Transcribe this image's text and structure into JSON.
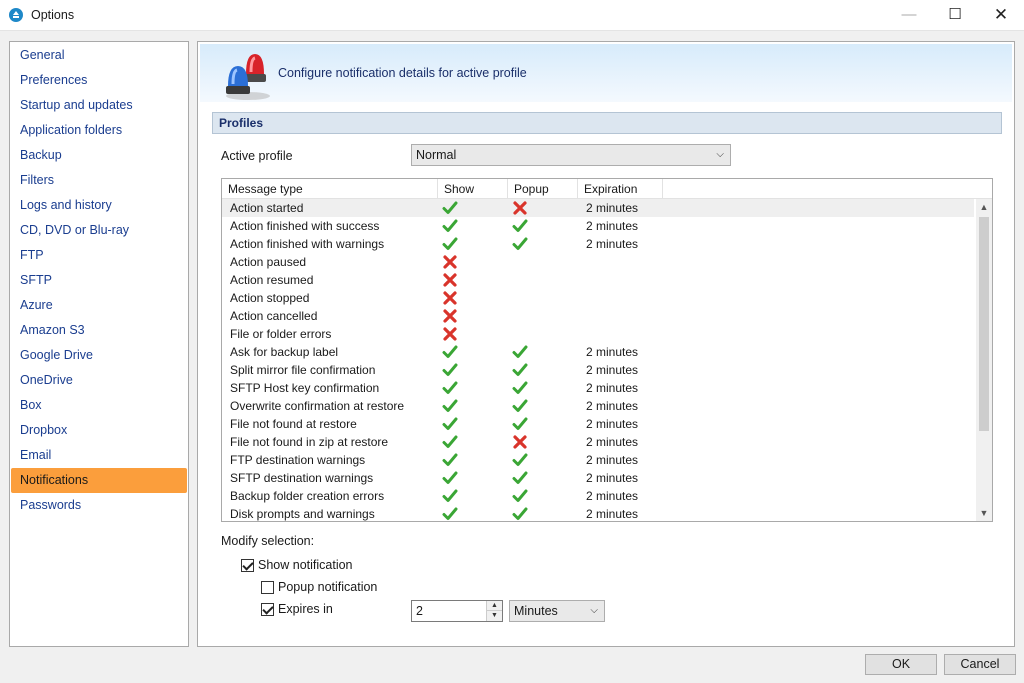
{
  "window": {
    "title": "Options"
  },
  "sidebar": {
    "items": [
      {
        "label": "General"
      },
      {
        "label": "Preferences"
      },
      {
        "label": "Startup and updates"
      },
      {
        "label": "Application folders"
      },
      {
        "label": "Backup"
      },
      {
        "label": "Filters"
      },
      {
        "label": "Logs and history"
      },
      {
        "label": "CD, DVD or Blu-ray"
      },
      {
        "label": "FTP"
      },
      {
        "label": "SFTP"
      },
      {
        "label": "Azure"
      },
      {
        "label": "Amazon S3"
      },
      {
        "label": "Google Drive"
      },
      {
        "label": "OneDrive"
      },
      {
        "label": "Box"
      },
      {
        "label": "Dropbox"
      },
      {
        "label": "Email"
      },
      {
        "label": "Notifications",
        "active": true
      },
      {
        "label": "Passwords"
      }
    ]
  },
  "banner": {
    "text": "Configure notification details for active profile",
    "icon": "siren-icon"
  },
  "profiles": {
    "section_title": "Profiles",
    "active_profile_label": "Active profile",
    "active_profile_value": "Normal"
  },
  "table": {
    "columns": [
      "Message type",
      "Show",
      "Popup",
      "Expiration"
    ],
    "rows": [
      {
        "type": "Action started",
        "show": true,
        "popup": false,
        "expiration": "2 minutes",
        "selected": true
      },
      {
        "type": "Action finished with success",
        "show": true,
        "popup": true,
        "expiration": "2 minutes"
      },
      {
        "type": "Action finished with warnings",
        "show": true,
        "popup": true,
        "expiration": "2 minutes"
      },
      {
        "type": "Action paused",
        "show": false,
        "popup": null,
        "expiration": ""
      },
      {
        "type": "Action resumed",
        "show": false,
        "popup": null,
        "expiration": ""
      },
      {
        "type": "Action stopped",
        "show": false,
        "popup": null,
        "expiration": ""
      },
      {
        "type": "Action cancelled",
        "show": false,
        "popup": null,
        "expiration": ""
      },
      {
        "type": "File or folder errors",
        "show": false,
        "popup": null,
        "expiration": ""
      },
      {
        "type": "Ask for backup label",
        "show": true,
        "popup": true,
        "expiration": "2 minutes"
      },
      {
        "type": "Split mirror file confirmation",
        "show": true,
        "popup": true,
        "expiration": "2 minutes"
      },
      {
        "type": "SFTP Host key confirmation",
        "show": true,
        "popup": true,
        "expiration": "2 minutes"
      },
      {
        "type": "Overwrite confirmation at restore",
        "show": true,
        "popup": true,
        "expiration": "2 minutes"
      },
      {
        "type": "File not found at restore",
        "show": true,
        "popup": true,
        "expiration": "2 minutes"
      },
      {
        "type": "File not found in zip at restore",
        "show": true,
        "popup": false,
        "expiration": "2 minutes"
      },
      {
        "type": "FTP destination warnings",
        "show": true,
        "popup": true,
        "expiration": "2 minutes"
      },
      {
        "type": "SFTP destination warnings",
        "show": true,
        "popup": true,
        "expiration": "2 minutes"
      },
      {
        "type": "Backup folder creation errors",
        "show": true,
        "popup": true,
        "expiration": "2 minutes"
      },
      {
        "type": "Disk prompts and warnings",
        "show": true,
        "popup": true,
        "expiration": "2 minutes"
      }
    ]
  },
  "modify": {
    "label": "Modify selection:",
    "show_notification": {
      "label": "Show notification",
      "checked": true
    },
    "popup_notification": {
      "label": "Popup notification",
      "checked": false
    },
    "expires_in": {
      "label": "Expires in",
      "checked": true,
      "value": "2",
      "unit": "Minutes"
    }
  },
  "buttons": {
    "ok": "OK",
    "cancel": "Cancel"
  },
  "colors": {
    "accent": "#fb9e3c",
    "link": "#1a3d8f",
    "check_green": "#3aa635",
    "cross_red": "#d9342b"
  }
}
